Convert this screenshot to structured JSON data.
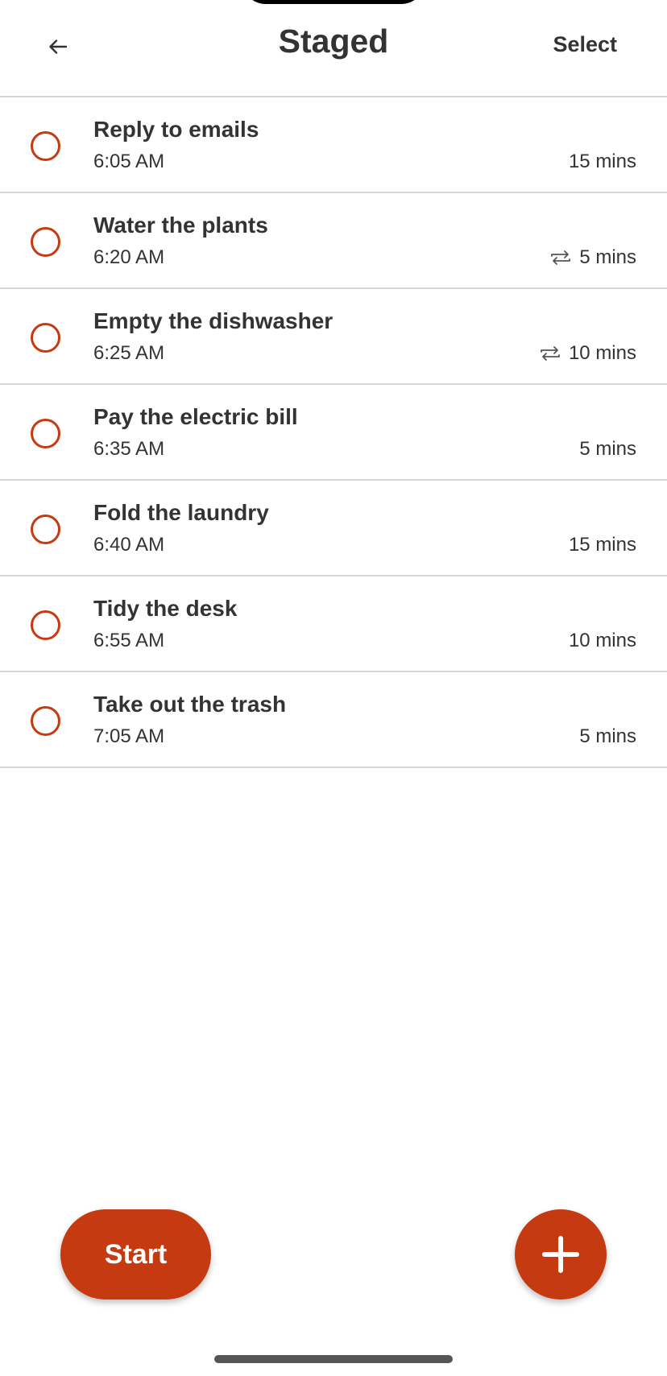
{
  "header": {
    "title": "Staged",
    "select_label": "Select",
    "back_icon": "arrow-left-icon"
  },
  "tasks": [
    {
      "name": "Reply to emails",
      "time": "6:05 AM",
      "duration": "15 mins",
      "repeat": false
    },
    {
      "name": "Water the plants",
      "time": "6:20 AM",
      "duration": "5 mins",
      "repeat": true
    },
    {
      "name": "Empty the dishwasher",
      "time": "6:25 AM",
      "duration": "10 mins",
      "repeat": true
    },
    {
      "name": "Pay the electric bill",
      "time": "6:35 AM",
      "duration": "5 mins",
      "repeat": false
    },
    {
      "name": "Fold the laundry",
      "time": "6:40 AM",
      "duration": "15 mins",
      "repeat": false
    },
    {
      "name": "Tidy the desk",
      "time": "6:55 AM",
      "duration": "10 mins",
      "repeat": false
    },
    {
      "name": "Take out the trash",
      "time": "7:05 AM",
      "duration": "5 mins",
      "repeat": false
    }
  ],
  "footer": {
    "start_label": "Start",
    "add_icon": "plus-icon"
  },
  "colors": {
    "accent": "#c53a10",
    "text": "#333333",
    "divider": "#d5d5d5"
  }
}
